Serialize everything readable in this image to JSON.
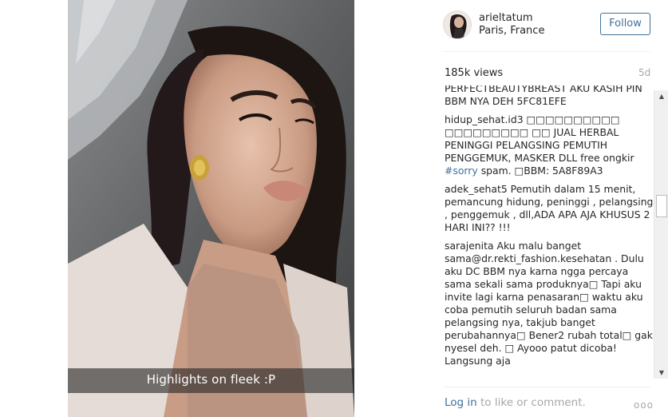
{
  "post": {
    "image_caption": "Highlights on fleek :P"
  },
  "header": {
    "username": "arieltatum",
    "location": "Paris, France",
    "follow_label": "Follow"
  },
  "stats": {
    "views": "185k views",
    "age": "5d"
  },
  "comments": [
    {
      "author": "",
      "text": "PERFECTBEAUTYBREAST AKU KASIH PIN BBM NYA DEH 5FC81EFE",
      "tag": "",
      "text_after": ""
    },
    {
      "author": "hidup_sehat.id3",
      "text": "□□□□□□□□□□ □□□□□□□□□ □□ JUAL HERBAL PENINGGI PELANGSING PEMUTIH PENGGEMUK, MASKER DLL free ongkir",
      "tag": "#sorry",
      "text_after": "spam. □BBM: 5A8F89A3"
    },
    {
      "author": "adek_sehat5",
      "text": "Pemutih dalam 15 menit, pemancung hidung, peninggi , pelangsing , penggemuk , dll,ADA APA AJA KHUSUS 2 HARI INI?? !!!",
      "tag": "",
      "text_after": ""
    },
    {
      "author": "sarajenita",
      "text": "Aku malu banget sama@dr.rekti_fashion.kesehatan . Dulu aku DC BBM nya karna ngga percaya sama sekali sama produknya□ Tapi aku invite lagi karna penasaran□ waktu aku coba pemutih seluruh badan sama pelangsing nya, takjub banget perubahannya□ Bener2 rubah total□ gak nyesel deh. □ Ayooo patut dicoba! Langsung aja",
      "tag": "",
      "text_after": ""
    }
  ],
  "footer": {
    "login_link": "Log in",
    "login_rest": " to like or comment.",
    "more_icon": "ooo"
  },
  "icons": {
    "scroll_up": "▲",
    "scroll_down": "▼"
  },
  "colors": {
    "link_blue": "#3f729b",
    "muted_gray": "#a5a7aa"
  }
}
